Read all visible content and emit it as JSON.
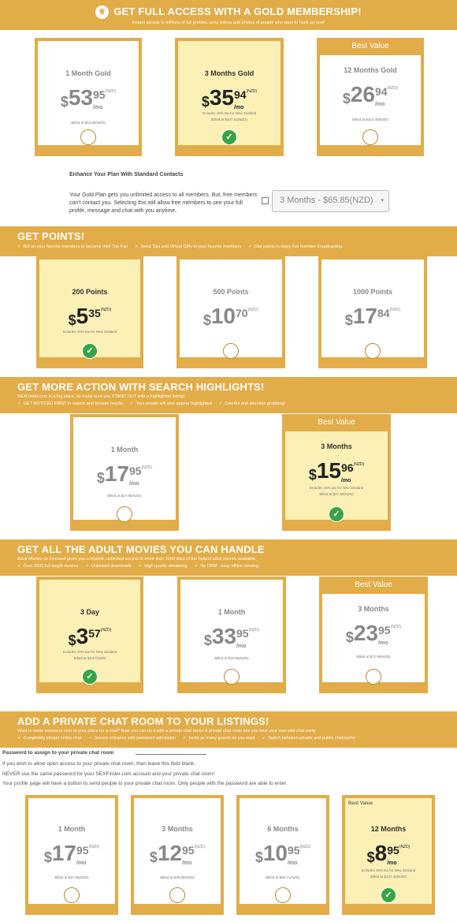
{
  "gold": {
    "title": "GET FULL ACCESS WITH A GOLD MEMBERSHIP!",
    "subtitle": "Instant access to millions of full profiles, sexy videos and photos of people who want to hook up now!",
    "plans": [
      {
        "name": "1 Month Gold",
        "cur": "$",
        "big": "53",
        "dec": "95",
        "nzd": "(NZD)",
        "per": "/mo",
        "tax": "",
        "billed": "Billed at $53.95(NZD)"
      },
      {
        "name": "3 Months Gold",
        "cur": "$",
        "big": "35",
        "dec": "94",
        "nzd": "(NZD)",
        "per": "/mo",
        "tax": "Includes 15% tax for New Zealand",
        "billed": "Billed at $107.81(NZD)"
      },
      {
        "name": "12 Months Gold",
        "cur": "$",
        "big": "26",
        "dec": "94",
        "nzd": "(NZD)",
        "per": "/mo",
        "tax": "",
        "billed": "Billed at $323.40(NZD)"
      }
    ],
    "best_value": "Best Value",
    "enhance_title": "Enhance Your Plan With Standard Contacts",
    "enhance_text": "Your Gold Plan gets you unlimited access to all members. But, free members can't contact you. Selecting this will allow free members to see your full profile, message and chat with you anytime.",
    "enhance_select": "3 Months - $65.85(NZD)"
  },
  "points": {
    "title": "GET POINTS!",
    "checks": [
      "Bid on your favorite members to become their Top Fan",
      "Send Tips and Virtual Gifts to your favorite members",
      "Use points to enjoy live member broadcasting"
    ],
    "plans": [
      {
        "name": "200 Points",
        "cur": "$",
        "big": "5",
        "dec": "35",
        "nzd": "(NZD)",
        "tax": "Includes 15% tax for New Zealand"
      },
      {
        "name": "500 Points",
        "cur": "$",
        "big": "10",
        "dec": "70",
        "nzd": "(NZD)"
      },
      {
        "name": "1000 Points",
        "cur": "$",
        "big": "17",
        "dec": "84",
        "nzd": "(NZD)"
      }
    ]
  },
  "highlights": {
    "title": "GET MORE ACTION WITH SEARCH HIGHLIGHTS!",
    "subtitle": "SEXFinder.com is a big place, so make sure you STAND OUT with a highlighted listing!",
    "checks": [
      "GET NOTICED FIRST in search and browse results",
      "Your emails will also appear highlighted",
      "Colorful and attention grabbing!"
    ],
    "plans": [
      {
        "name": "1 Month",
        "cur": "$",
        "big": "17",
        "dec": "95",
        "nzd": "(NZD)",
        "per": "/mo",
        "billed": "Billed at $17.95(NZD)"
      },
      {
        "name": "3 Months",
        "cur": "$",
        "big": "15",
        "dec": "96",
        "nzd": "(NZD)",
        "per": "/mo",
        "tax": "Includes 15% tax for New Zealand",
        "billed": "Billed at $47.90(NZD)"
      }
    ]
  },
  "movies": {
    "title": "GET ALL THE ADULT MOVIES YOU CAN HANDLE",
    "subtitle": "Adult Movies on Demand gives you complete, unlimited access to more than 2000 titles of the hottest adult movies available.",
    "checks": [
      "Over 2000 full length movies",
      "Unlimited downloads",
      "High quality streaming",
      "No DRM - easy offline viewing"
    ],
    "plans": [
      {
        "name": "3 Day",
        "cur": "$",
        "big": "3",
        "dec": "57",
        "nzd": "(NZD)",
        "tax": "Includes 15% tax for New Zealand",
        "billed": "Billed at $3.57(NZD)"
      },
      {
        "name": "1 Month",
        "cur": "$",
        "big": "33",
        "dec": "95",
        "nzd": "(NZD)",
        "per": "/mo",
        "billed": "Billed at $33.95(NZD)"
      },
      {
        "name": "3 Months",
        "cur": "$",
        "big": "23",
        "dec": "95",
        "nzd": "(NZD)",
        "per": "/mo",
        "billed": "Billed at $71.85(NZD)"
      }
    ]
  },
  "chat": {
    "title": "ADD A PRIVATE CHAT ROOM TO YOUR LISTINGS!",
    "subtitle": "Want to invite someone over to your place for a chat? Now you can do it with a private chat room! A private chat room lets you host your own wild chat party.",
    "checks": [
      "Completely private online chat",
      "Secure entrance with password admission",
      "Invite as many guests as you want",
      "Switch between private and public chatrooms"
    ],
    "password_label": "Password to assign to your private chat room",
    "notes": [
      "If you wish to allow open access to your private chat room, then leave this field blank.",
      "NEVER use the same password for your SEXFinder.com account and your private chat room!",
      "Your profile page will have a button to send people to your private chat room. Only people with the password are able to enter."
    ],
    "plans": [
      {
        "name": "1 Month",
        "cur": "$",
        "big": "17",
        "dec": "95",
        "nzd": "(NZD)",
        "per": "/mo",
        "billed": "Billed at $17.95(NZD)"
      },
      {
        "name": "3 Months",
        "cur": "$",
        "big": "12",
        "dec": "95",
        "nzd": "(NZD)",
        "per": "/mo",
        "billed": "Billed at $38.86(NZD)"
      },
      {
        "name": "6 Months",
        "cur": "$",
        "big": "10",
        "dec": "95",
        "nzd": "(NZD)",
        "per": "/mo",
        "billed": "Billed at $65.71(NZD)"
      },
      {
        "name": "12 Months",
        "cur": "$",
        "big": "8",
        "dec": "95",
        "nzd": "(NZD)",
        "per": "/mo",
        "tax": "Includes 15% tax for New Zealand",
        "billed": "Billed at $107.40(NZD)"
      }
    ]
  },
  "colors": {
    "gold": "#e2ac48",
    "selected": "#fbf0b6",
    "check": "#39a447"
  }
}
